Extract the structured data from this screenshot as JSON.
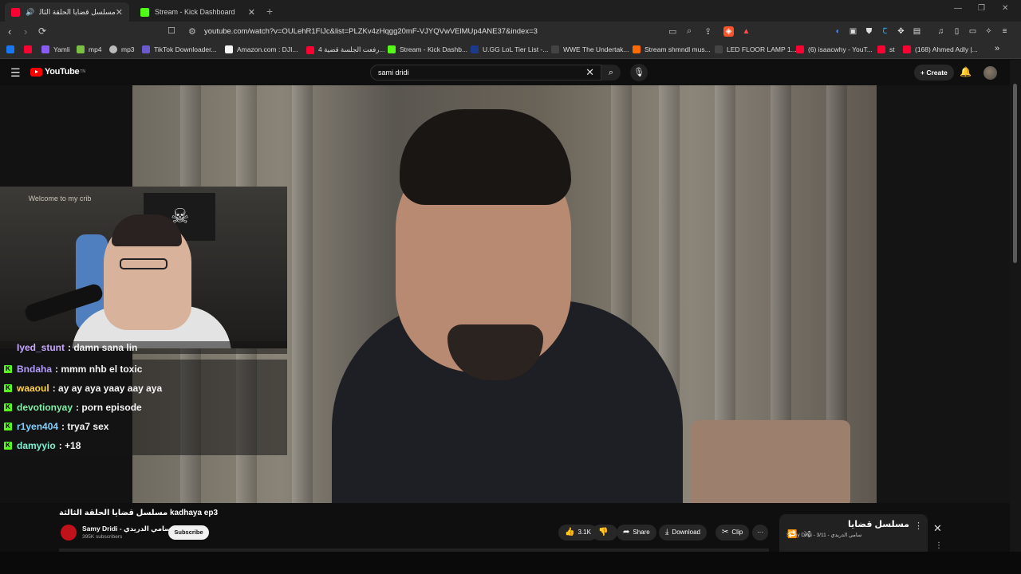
{
  "browser": {
    "tabs": [
      {
        "title": "مسلسل قضايا الحلقة الثالثة be",
        "close": "✕",
        "favicon_color": "#ff0033",
        "extra_favicon": "#ffffff"
      },
      {
        "title": "Stream - Kick Dashboard",
        "close": "✕",
        "favicon_color": "#53fc18"
      }
    ],
    "new_tab": "+",
    "url": "youtube.com/watch?v=OULehR1FIJc&list=PLZKv4zHqgg20mF-VJYQVwVElMUp4ANE37&index=3",
    "bookmarks": [
      {
        "label": "",
        "color": "#1877f2"
      },
      {
        "label": "",
        "color": "#ff0033"
      },
      {
        "label": "Yamli",
        "color": "#8a5cf6"
      },
      {
        "label": "mp4",
        "color": "#7ac043"
      },
      {
        "label": "mp3",
        "color": "#bbbbbb"
      },
      {
        "label": "TikTok Downloader...",
        "color": "#6a5acd"
      },
      {
        "label": "Amazon.com : DJI...",
        "color": "#f5f5f5"
      },
      {
        "label": "رفعت الجلسة قضية 4...",
        "color": "#ff0033"
      },
      {
        "label": "Stream - Kick Dashb...",
        "color": "#53fc18"
      },
      {
        "label": "U.GG LoL Tier List -...",
        "color": "#1b3a8a"
      },
      {
        "label": "WWE The Undertak...",
        "color": "#222222"
      },
      {
        "label": "Stream shmndl mus...",
        "color": "#ff6a00"
      },
      {
        "label": "LED FLOOR LAMP 1...",
        "color": "#222222"
      },
      {
        "label": "(6) isaacwhy - YouT...",
        "color": "#ff0033"
      },
      {
        "label": "st",
        "color": "#ff0033"
      },
      {
        "label": "(168) Ahmed Adly |...",
        "color": "#ff0033"
      }
    ],
    "bookmarks_more": "»"
  },
  "youtube": {
    "logo_text": "YouTube",
    "logo_sup": "TN",
    "search_value": "sami dridi",
    "create_label": "Create",
    "video": {
      "title": "مسلسل قضايا الحلقة الثالثة kadhaya ep3",
      "channel_name": "Samy Dridi - سامي الدريدي",
      "subscribers": "395K subscribers",
      "subscribe_label": "Subscribe",
      "likes": "3.1K",
      "share_label": "Share",
      "download_label": "Download",
      "clip_label": "Clip"
    },
    "playlist": {
      "title": "مسلسل قضايا",
      "subtitle": "Samy Dridi - سامي الدريدي - 3/11"
    }
  },
  "overlay": {
    "webcam_sign": "Welcome to my crib",
    "chat": [
      {
        "user": "Iyed_stunt",
        "message": ": damn sana lin",
        "color": "#c9a8ff"
      },
      {
        "user": "Bndaha",
        "message": ": mmm nhb el toxic",
        "color": "#b59cff"
      },
      {
        "user": "waaoul",
        "message": ": ay ay aya yaay aay aya",
        "color": "#ffd24d"
      },
      {
        "user": "devotionyay",
        "message": ": porn episode",
        "color": "#7ff0a5"
      },
      {
        "user": "r1yen404",
        "message": ": trya7 sex",
        "color": "#7fd0ff"
      },
      {
        "user": "damyyio",
        "message": ": +18",
        "color": "#7ff0d0"
      }
    ]
  }
}
